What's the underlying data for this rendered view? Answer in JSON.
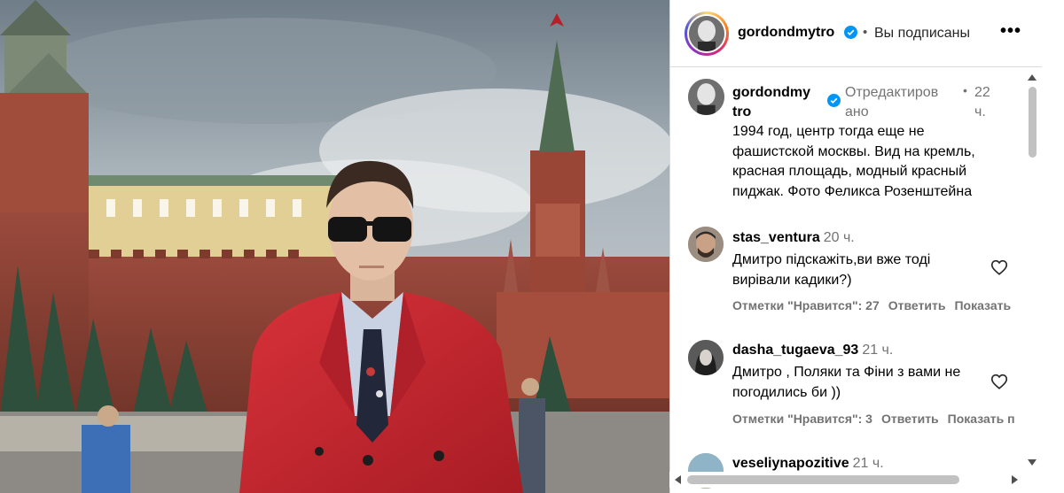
{
  "post": {
    "image_alt_icon": "photo-image"
  },
  "header": {
    "username": "gordondmytro",
    "separator": "•",
    "follow_status": "Вы подписаны",
    "more_label": "•••"
  },
  "caption": {
    "username": "gordondmytro",
    "edited": "Отредактировано",
    "dot": "•",
    "time": "22 ч.",
    "text": "1994 год, центр тогда еще не фашистской москвы. Вид на кремль, красная площадь, модный красный пиджак. Фото Феликса Розенштейна"
  },
  "comments": [
    {
      "username": "stas_ventura",
      "time": "20 ч.",
      "text": "Дмитро підскажіть,ви вже тоді вирівали кадики?)",
      "likes": "Отметки \"Нравится\": 27",
      "reply": "Ответить",
      "show": "Показать"
    },
    {
      "username": "dasha_tugaeva_93",
      "time": "21 ч.",
      "text": "Дмитро , Поляки та Фіни з вами не погодились би ))",
      "likes": "Отметки \"Нравится\": 3",
      "reply": "Ответить",
      "show": "Показать п"
    },
    {
      "username": "veseliynapozitive",
      "time": "21 ч."
    }
  ],
  "colors": {
    "verified": "#0095f6",
    "muted": "#737373",
    "jacket": "#c8262b"
  }
}
